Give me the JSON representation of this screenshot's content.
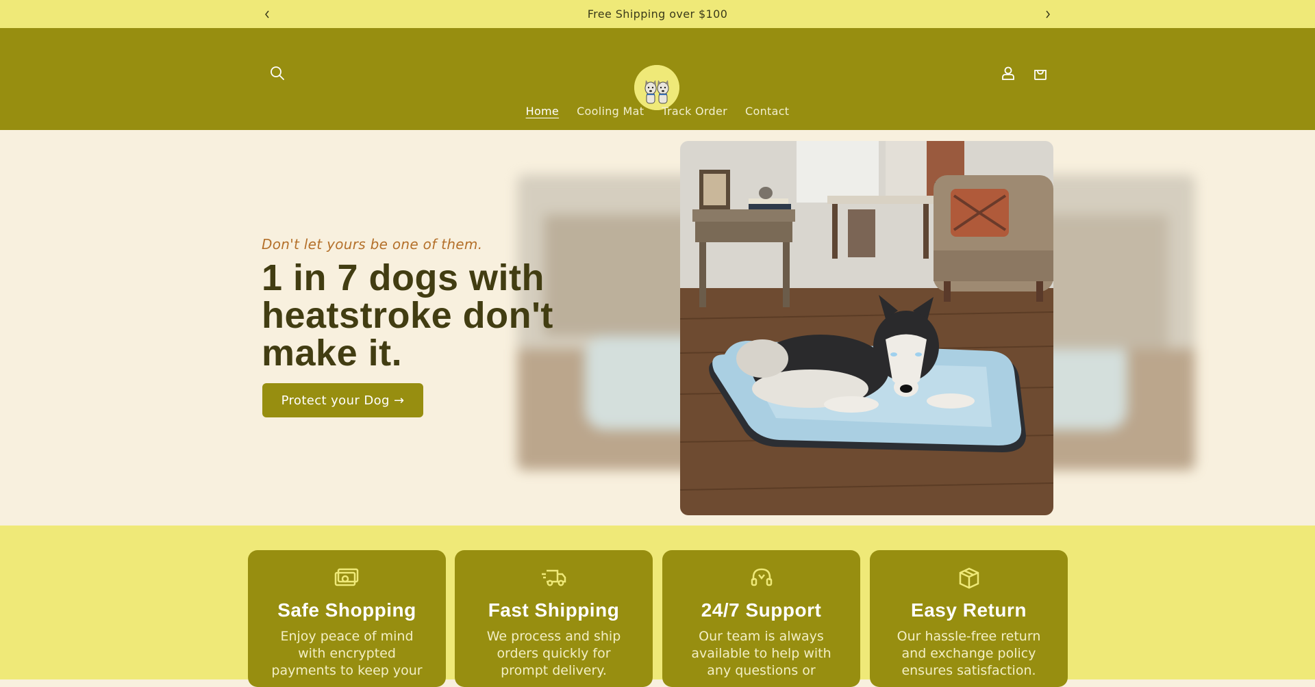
{
  "announcement": {
    "text": "Free Shipping over $100"
  },
  "header": {
    "icons": {
      "search": "search-icon",
      "account": "user-icon",
      "cart": "bag-icon"
    }
  },
  "nav": {
    "items": [
      {
        "label": "Home"
      },
      {
        "label": "Cooling Mat"
      },
      {
        "label": "Track Order"
      },
      {
        "label": "Contact"
      }
    ]
  },
  "hero": {
    "tagline": "Don't let yours be one of them.",
    "headline": "1 in 7 dogs with heatstroke don't make it.",
    "cta_label": "Protect your Dog →"
  },
  "features": [
    {
      "title": "Safe Shopping",
      "description": "Enjoy peace of mind with encrypted payments to keep your",
      "icon": "cash-icon"
    },
    {
      "title": "Fast Shipping",
      "description": "We process and ship orders quickly for prompt delivery.",
      "icon": "truck-icon"
    },
    {
      "title": "24/7 Support",
      "description": "Our team is always available to help with any questions or",
      "icon": "headset-icon"
    },
    {
      "title": "Easy Return",
      "description": "Our hassle-free return and exchange policy ensures satisfaction.",
      "icon": "box-icon"
    }
  ],
  "colors": {
    "announcement_bg": "#efe978",
    "brand": "#978e10",
    "hero_bg": "#f8f0de",
    "headline": "#423d12",
    "tagline": "#b4702a"
  }
}
